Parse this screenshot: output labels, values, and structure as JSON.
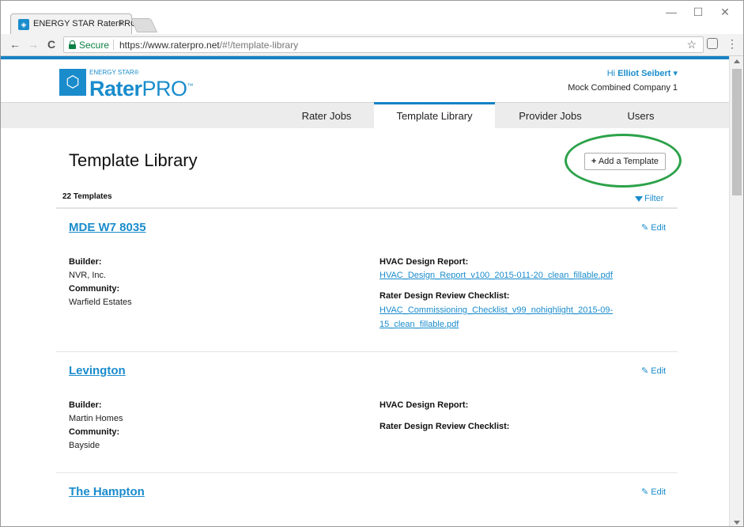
{
  "browser": {
    "tab_title": "ENERGY STAR RaterPRO",
    "tab_close": "×",
    "secure_label": "Secure",
    "url_host": "https://www.raterpro.net",
    "url_path": "/#!/template-library",
    "controls": {
      "minimize": "—",
      "maximize": "☐",
      "close": "✕"
    },
    "nav": {
      "back": "←",
      "forward": "→",
      "reload": "C"
    },
    "star": "☆",
    "menu": "⋮"
  },
  "header": {
    "logo_energy_star": "ENERGY STAR®",
    "logo_rater": "Rater",
    "logo_pro": "PRO",
    "logo_tm": "™",
    "greeting_prefix": "Hi",
    "user_name": "Elliot Seibert",
    "company": "Mock Combined Company 1"
  },
  "nav": {
    "items": [
      {
        "label": "Rater Jobs"
      },
      {
        "label": "Template Library"
      },
      {
        "label": "Provider Jobs"
      },
      {
        "label": "Users"
      }
    ],
    "active": "Template Library"
  },
  "main": {
    "title": "Template Library",
    "add_button": "Add a Template",
    "count": "22 Templates",
    "filter": "Filter"
  },
  "labels": {
    "builder": "Builder:",
    "community": "Community:",
    "hvac_report": "HVAC Design Report:",
    "rater_checklist": "Rater Design Review Checklist:",
    "edit": "Edit"
  },
  "templates": [
    {
      "name": "MDE W7 8035",
      "builder": "NVR, Inc.",
      "community": "Warfield Estates",
      "hvac_report_file": "HVAC_Design_Report_v100_2015-011-20_clean_fillable.pdf",
      "checklist_file_line1": "HVAC_Commissioning_Checklist_v99_nohighlight_2015-09-",
      "checklist_file_line2": "15_clean_fillable.pdf"
    },
    {
      "name": "Levington",
      "builder": "Martin Homes",
      "community": "Bayside",
      "hvac_report_file": "",
      "checklist_file_line1": "",
      "checklist_file_line2": ""
    },
    {
      "name": "The Hampton"
    }
  ],
  "colors": {
    "accent": "#1582c4",
    "link": "#1a8ccc",
    "highlight_ring": "#2ca24a"
  }
}
